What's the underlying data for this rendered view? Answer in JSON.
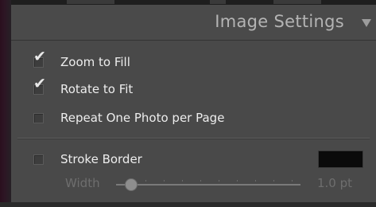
{
  "panel": {
    "title": "Image Settings",
    "collapse_icon": "triangle-down-icon"
  },
  "options": [
    {
      "label": "Zoom to Fill",
      "checked": true
    },
    {
      "label": "Rotate to Fit",
      "checked": true
    },
    {
      "label": "Repeat One Photo per Page",
      "checked": false
    }
  ],
  "stroke": {
    "label": "Stroke Border",
    "checked": false,
    "color": "#0a0a0a",
    "width_label": "Width",
    "width_value": "1.0 pt"
  },
  "checkmark_glyph": "✔"
}
